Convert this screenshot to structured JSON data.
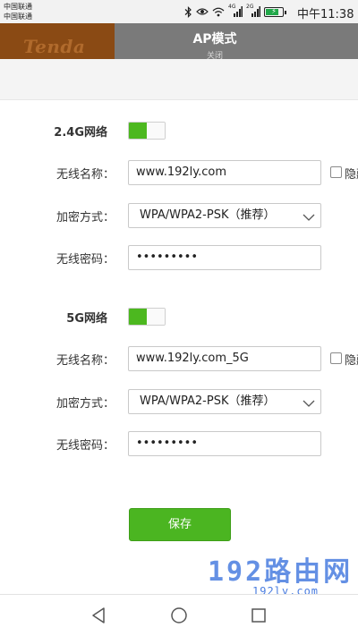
{
  "status_bar": {
    "carrier_1": "中国联通",
    "carrier_2": "中国联通",
    "network_1": "4G",
    "network_2": "2G",
    "time": "中午11:38",
    "battery_level": 0.85,
    "icons": [
      "bluetooth-icon",
      "eye-icon",
      "wifi-icon",
      "signal-icon",
      "signal-icon",
      "battery-icon"
    ]
  },
  "header": {
    "logo": "Tenda",
    "title": "AP模式",
    "subtitle": "关闭"
  },
  "networks": [
    {
      "band_label": "2.4G网络",
      "enabled": true,
      "ssid_label": "无线名称：",
      "ssid_value": "www.192ly.com",
      "hide_label": "隐藏",
      "security_label": "加密方式：",
      "security_value": "WPA/WPA2-PSK（推荐）",
      "password_label": "无线密码：",
      "password_value": "•••••••••"
    },
    {
      "band_label": "5G网络",
      "enabled": true,
      "ssid_label": "无线名称：",
      "ssid_value": "www.192ly.com_5G",
      "hide_label": "隐藏",
      "security_label": "加密方式：",
      "security_value": "WPA/WPA2-PSK（推荐）",
      "password_label": "无线密码：",
      "password_value": "•••••••••"
    }
  ],
  "save_label": "保存",
  "watermark": {
    "main": "192路由网",
    "url": "192ly.com"
  },
  "colors": {
    "accent_green": "#4bb521",
    "header_grey": "#7a7a7a",
    "logo_brown": "#8a4a14",
    "watermark_blue": "#4a7de0"
  }
}
